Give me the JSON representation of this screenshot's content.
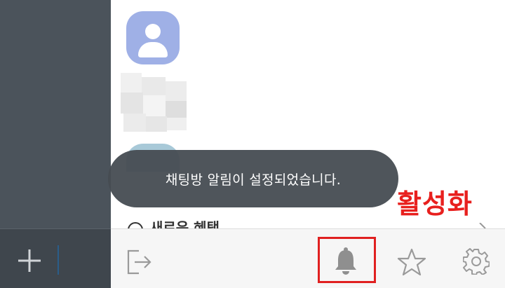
{
  "toast": {
    "message": "채팅방 알림이 설정되었습니다."
  },
  "menu": {
    "partial_item_label": "새로운 혜택"
  },
  "annotation": {
    "label": "활성화",
    "color": "#e8201e"
  },
  "bottom_bar": {
    "icons": [
      "exit-icon",
      "bell-icon",
      "star-icon",
      "gear-icon"
    ],
    "active": "bell-icon"
  },
  "colors": {
    "left_panel": "#4b535b",
    "avatar": "#9fb0e6",
    "toast_bg": "#464c52",
    "highlight": "#e02020"
  }
}
